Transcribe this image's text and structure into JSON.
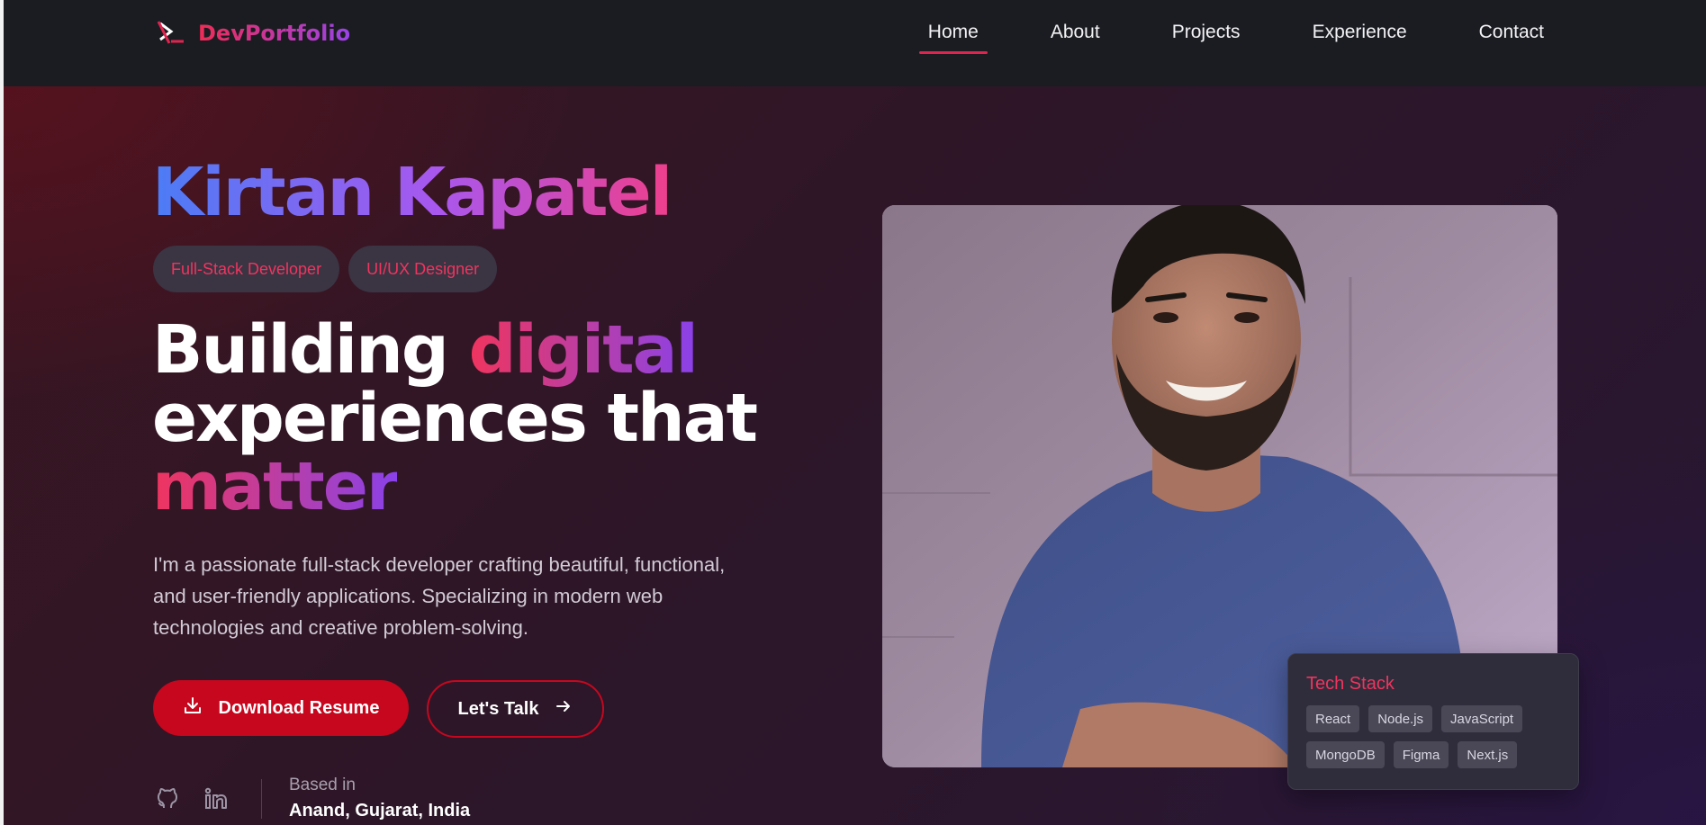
{
  "nav": {
    "brand": "DevPortfolio",
    "links": [
      "Home",
      "About",
      "Projects",
      "Experience",
      "Contact"
    ],
    "active": "Home"
  },
  "hero": {
    "name": "Kirtan Kapatel",
    "roles": [
      "Full-Stack Developer",
      "UI/UX Designer"
    ],
    "headline": {
      "part1": "Building ",
      "highlight1": "digital",
      "part2": "experiences that",
      "highlight2": "matter"
    },
    "intro": "I'm a passionate full-stack developer crafting beautiful, functional, and user-friendly applications. Specializing in modern web technologies and creative problem-solving.",
    "primary_button": "Download Resume",
    "secondary_button": "Let's Talk",
    "location_label": "Based in",
    "location_value": "Anand, Gujarat, India"
  },
  "tech_stack": {
    "title": "Tech Stack",
    "tags": [
      "React",
      "Node.js",
      "JavaScript",
      "MongoDB",
      "Figma",
      "Next.js"
    ]
  },
  "colors": {
    "accent": "#c6071e",
    "accent_pink": "#f0345e",
    "nav_bg": "#1b1c22",
    "gradient_blue": "#4b7cf6",
    "gradient_purple": "#a957ee"
  },
  "icons": [
    "logo-icon",
    "download-icon",
    "arrow-right-icon",
    "github-icon",
    "linkedin-icon"
  ]
}
